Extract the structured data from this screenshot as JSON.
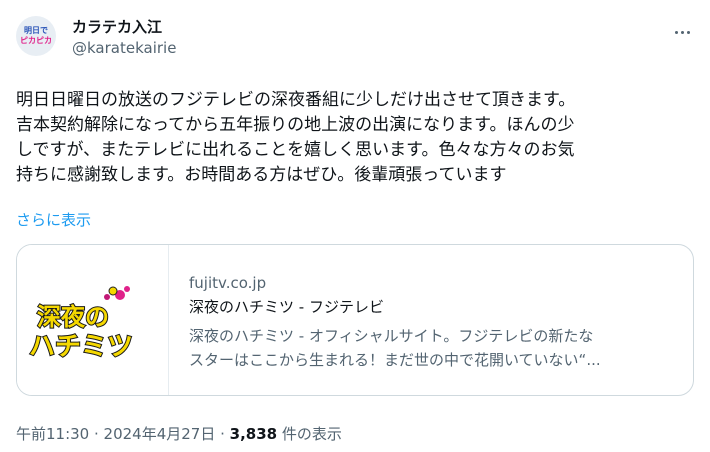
{
  "author": {
    "display_name": "カラテカ入江",
    "handle": "@karatekairie",
    "avatar_text_top": "明日で",
    "avatar_text_mark": "ピカピカ"
  },
  "tweet": {
    "text": "明日日曜日の放送のフジテレビの深夜番組に少しだけ出させて頂きます。\n吉本契約解除になってから五年振りの地上波の出演になります。ほんの少\nしですが、またテレビに出れることを嬉しく思います。色々な方々のお気\n持ちに感謝致します。お時間ある方はぜひ。後輩頑張っています",
    "show_more": "さらに表示"
  },
  "link_card": {
    "domain": "fujitv.co.jp",
    "title": "深夜のハチミツ - フジテレビ",
    "description": "深夜のハチミツ - オフィシャルサイト。フジテレビの新たな\nスターはここから生まれる！まだ世の中で花開いていない“...",
    "logo_line1": "深夜の",
    "logo_line2": "ハチミツ"
  },
  "meta": {
    "time": "午前11:30",
    "separator": " · ",
    "date": "2024年4月27日",
    "views_count": "3,838",
    "views_label": " 件の表示"
  },
  "colors": {
    "text": "#0f1419",
    "secondary": "#536471",
    "link": "#1d9bf0",
    "logo_yellow": "#f5d800",
    "logo_pink": "#e0218a"
  },
  "icons": {
    "more": "ellipsis-horizontal-icon"
  }
}
